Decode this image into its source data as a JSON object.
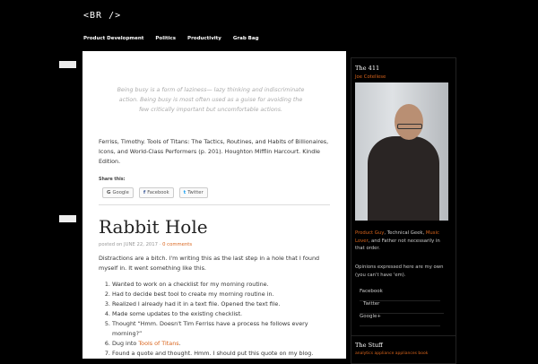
{
  "site": {
    "title": "<BR />"
  },
  "nav": [
    "Product Development",
    "Politics",
    "Productivity",
    "Grab Bag"
  ],
  "quote": "Being busy is a form of laziness— lazy thinking and indiscriminate action. Being busy is most often used as a guise for avoiding the few critically important but uncomfortable actions.",
  "citation": "Ferriss, Timothy. Tools of Titans: The Tactics, Routines, and Habits of Billionaires, Icons, and World-Class Performers (p. 201). Houghton Mifflin Harcourt. Kindle Edition.",
  "share": {
    "label": "Share this:",
    "buttons": [
      {
        "icon": "G",
        "label": "Google"
      },
      {
        "icon": "f",
        "label": "Facebook"
      },
      {
        "icon": "t",
        "label": "Twitter"
      }
    ]
  },
  "post": {
    "title": "Rabbit Hole",
    "meta_prefix": "posted on JUNE 22, 2017 · ",
    "comments": "0 comments",
    "intro": "Distractions are a bitch. I'm writing this as the last step in a hole that I found myself in. It went something like this.",
    "steps": [
      "Wanted to work on a checklist for my morning routine.",
      "Had to decide best tool to create my morning routine in.",
      "Realized I already had it in a text file. Opened the text file.",
      "Made some updates to the existing checklist.",
      "Thought “Hmm. Doesn't Tim Ferriss have a process he follows every morning?”",
      "Dug into ",
      "Found a quote and thought. Hmm. I should put this quote on my blog."
    ],
    "step6_link": "Tools of Titans",
    "step6_end": "."
  },
  "sidebar": {
    "title": "The 411",
    "name": "Joe Cotellese",
    "bio_link1": "Product Guy",
    "bio_mid": ", Technical Geek, ",
    "bio_link2": "Music Lover",
    "bio_end": ", and Father not necessarily in that order.",
    "opinions": "Opinions expressed here are my own (you can't have 'em).",
    "social": [
      "Facebook",
      "Twitter",
      "Google+"
    ]
  },
  "sidebar2": {
    "title": "The Stuff",
    "tags": "analytics appliance appliances book"
  }
}
